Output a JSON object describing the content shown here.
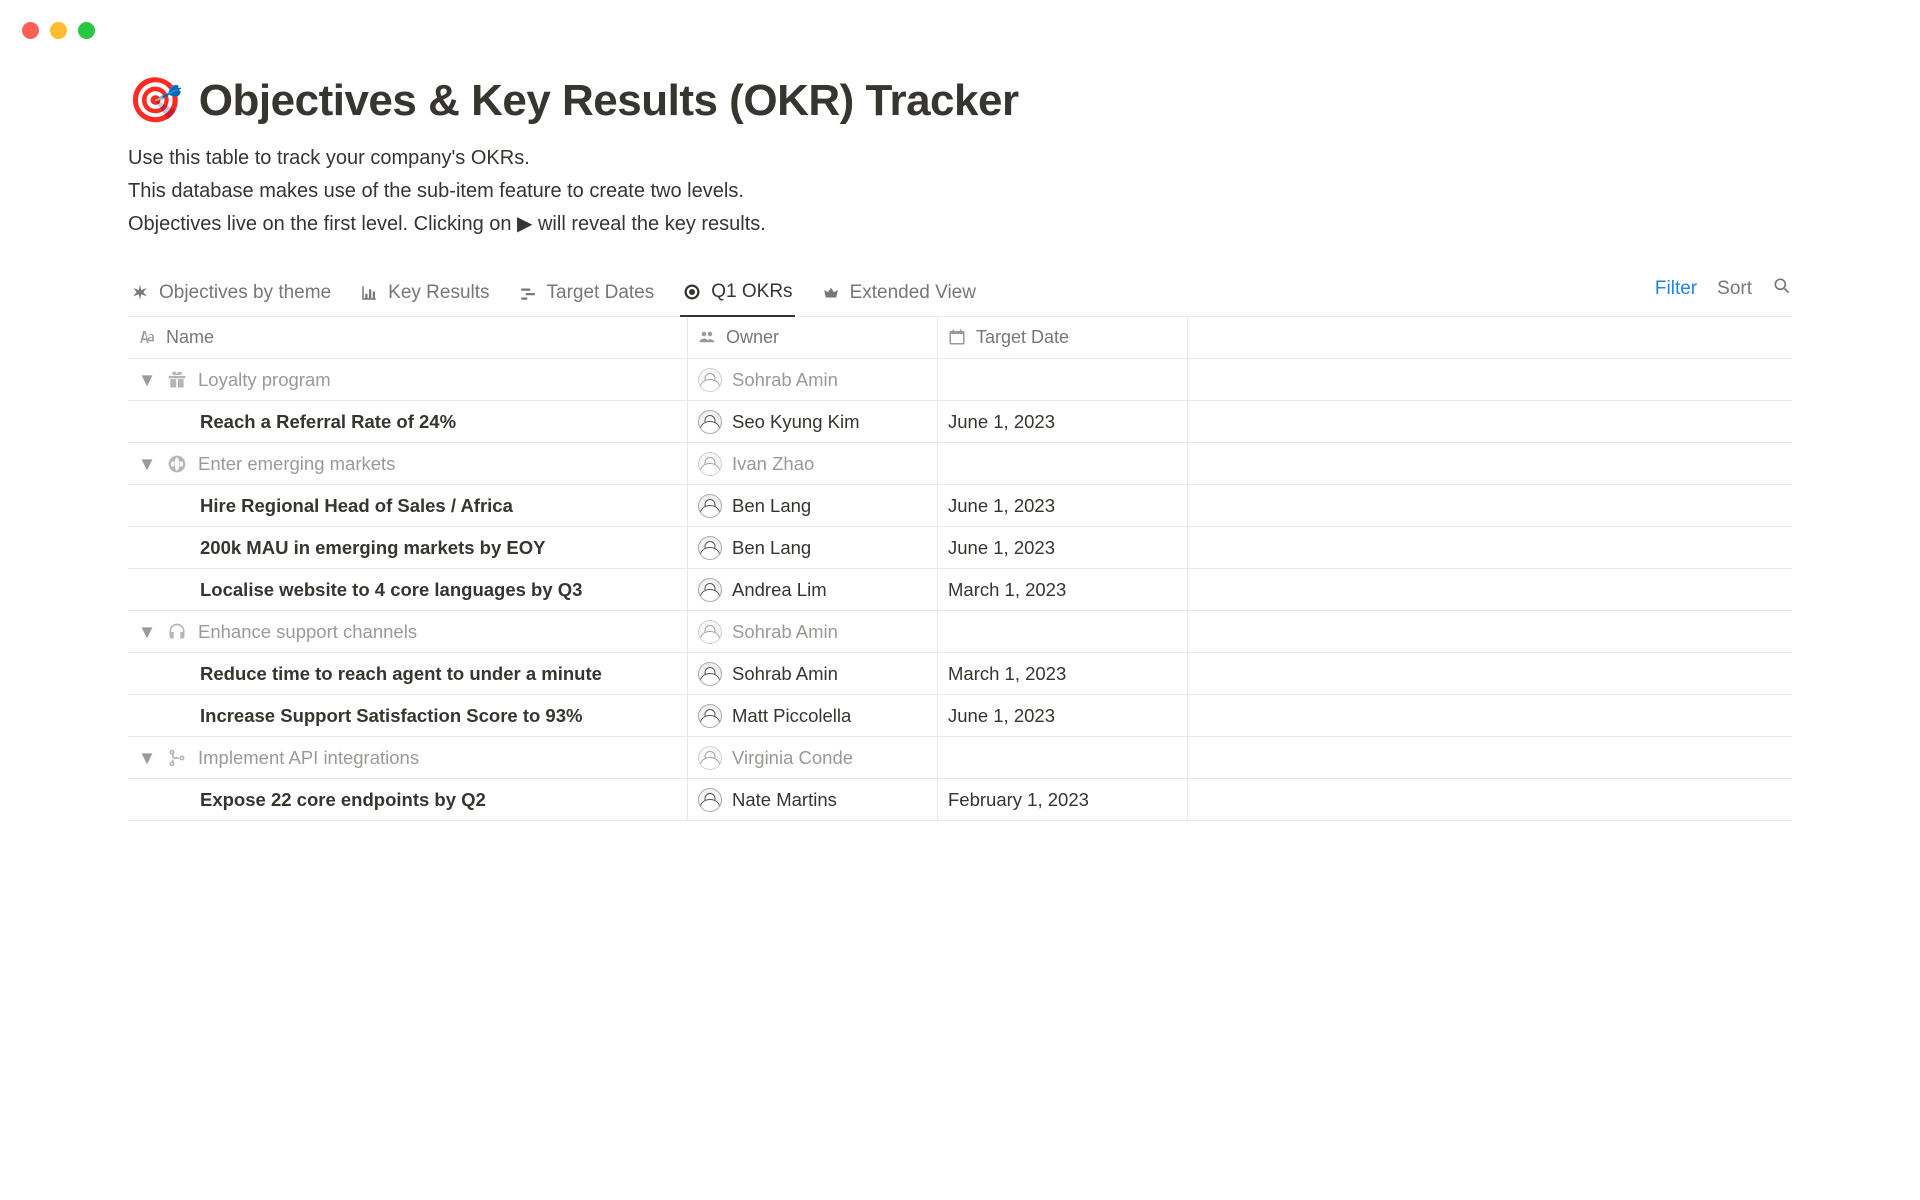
{
  "page": {
    "icon": "🎯",
    "title": "Objectives & Key Results (OKR) Tracker",
    "desc1": "Use this table to track your company's OKRs.",
    "desc2": "This database makes use of the sub-item feature to create two levels.",
    "desc3": "Objectives live on the first level. Clicking on ▶ will reveal the key results."
  },
  "tabs": {
    "t0": "Objectives by theme",
    "t1": "Key Results",
    "t2": "Target Dates",
    "t3": "Q1 OKRs",
    "t4": "Extended View",
    "filter": "Filter",
    "sort": "Sort"
  },
  "columns": {
    "name": "Name",
    "owner": "Owner",
    "date": "Target Date"
  },
  "rows": {
    "o0": {
      "name": "Loyalty program",
      "owner": "Sohrab Amin"
    },
    "k0": {
      "name": "Reach a Referral Rate of 24%",
      "owner": "Seo Kyung Kim",
      "date": "June 1, 2023"
    },
    "o1": {
      "name": "Enter emerging markets",
      "owner": "Ivan Zhao"
    },
    "k1": {
      "name": "Hire Regional Head of Sales / Africa",
      "owner": "Ben Lang",
      "date": "June 1, 2023"
    },
    "k2": {
      "name": "200k MAU in emerging markets by EOY",
      "owner": "Ben Lang",
      "date": "June 1, 2023"
    },
    "k3": {
      "name": "Localise website to 4 core languages by Q3",
      "owner": "Andrea Lim",
      "date": "March 1, 2023"
    },
    "o2": {
      "name": "Enhance support channels",
      "owner": "Sohrab Amin"
    },
    "k4": {
      "name": "Reduce time to reach agent to under a minute",
      "owner": "Sohrab Amin",
      "date": "March 1, 2023"
    },
    "k5": {
      "name": "Increase Support Satisfaction Score to 93%",
      "owner": "Matt Piccolella",
      "date": "June 1, 2023"
    },
    "o3": {
      "name": "Implement API integrations",
      "owner": "Virginia Conde"
    },
    "k6": {
      "name": "Expose 22 core endpoints by Q2",
      "owner": "Nate Martins",
      "date": "February 1, 2023"
    }
  }
}
